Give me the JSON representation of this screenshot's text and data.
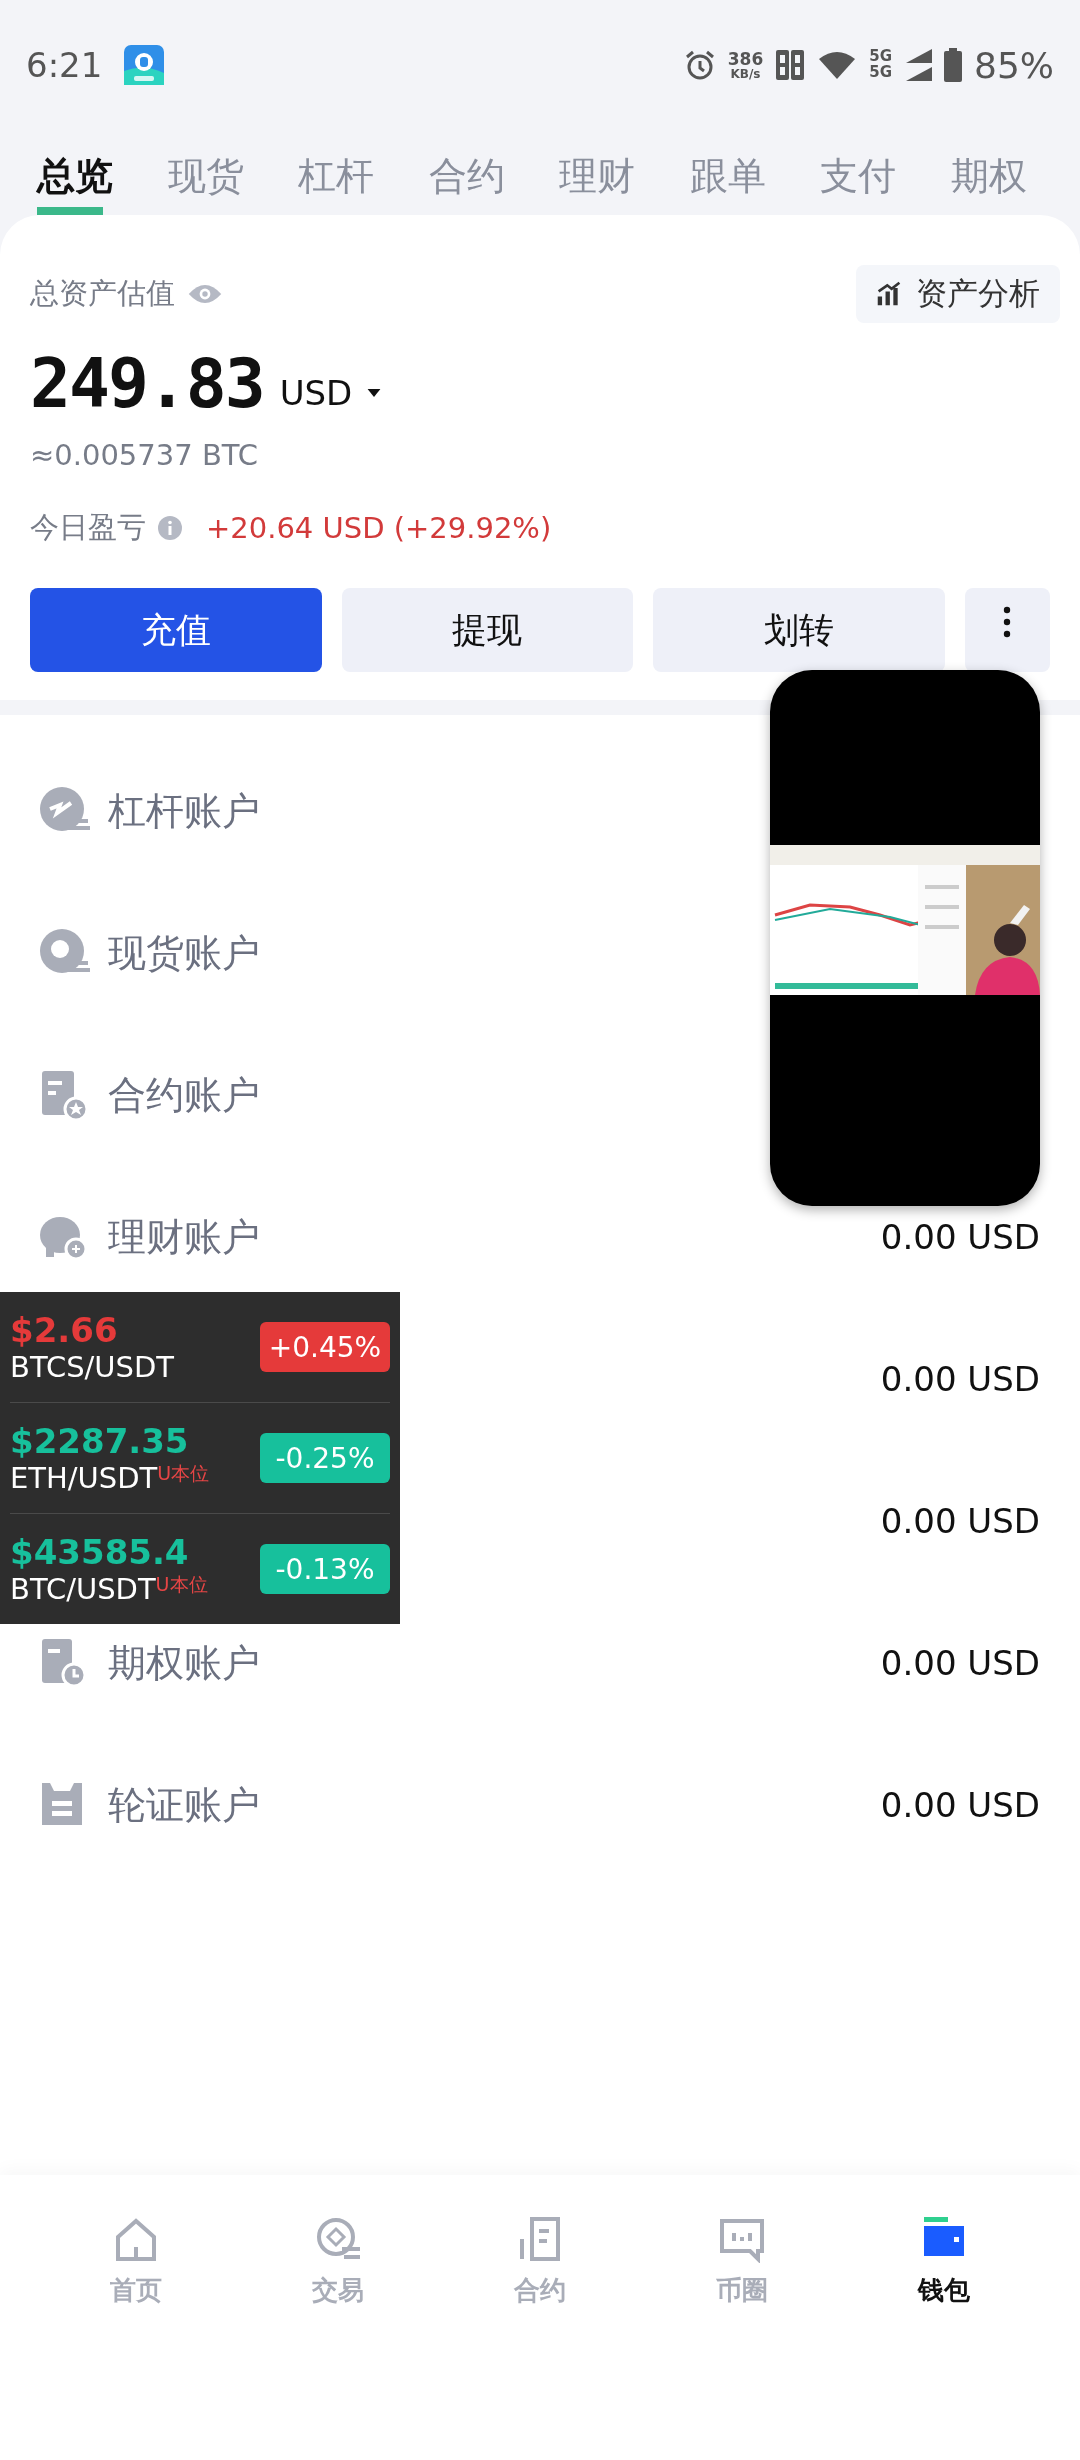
{
  "status_bar": {
    "time": "6:21",
    "network_speed": "386",
    "network_speed_unit": "KB/s",
    "signal_labels": [
      "5G",
      "5G"
    ],
    "battery": "85%"
  },
  "tabs": [
    {
      "label": "总览",
      "selected": true
    },
    {
      "label": "现货",
      "selected": false
    },
    {
      "label": "杠杆",
      "selected": false
    },
    {
      "label": "合约",
      "selected": false
    },
    {
      "label": "理财",
      "selected": false
    },
    {
      "label": "跟单",
      "selected": false
    },
    {
      "label": "支付",
      "selected": false
    },
    {
      "label": "期权",
      "selected": false
    }
  ],
  "assets": {
    "title": "总资产估值",
    "analysis_button": "资产分析",
    "total": "249.83",
    "currency": "USD",
    "btc_equivalent": "≈0.005737 BTC",
    "pnl_label": "今日盈亏",
    "pnl_value": "+20.64 USD (+29.92%)"
  },
  "actions": [
    {
      "label": "充值",
      "primary": true
    },
    {
      "label": "提现",
      "primary": false
    },
    {
      "label": "划转",
      "primary": false
    }
  ],
  "accounts": [
    {
      "name": "杠杆账户"
    },
    {
      "name": "现货账户"
    },
    {
      "name": "合约账户"
    },
    {
      "name": "理财账户",
      "value": "0.00 USD"
    },
    {
      "value": "0.00 USD"
    },
    {
      "value": "0.00 USD"
    },
    {
      "name": "期权账户",
      "value": "0.00 USD"
    },
    {
      "name": "轮证账户",
      "value": "0.00 USD"
    }
  ],
  "ticker": [
    {
      "price": "$2.66",
      "pair": "BTCS/USDT",
      "change": "+0.45%",
      "color": "#e53a3a"
    },
    {
      "price": "$2287.35",
      "pair": "ETH/USDT",
      "tag": "U本位",
      "change": "-0.25%",
      "color": "#17c09c"
    },
    {
      "price": "$43585.4",
      "pair": "BTC/USDT",
      "tag": "U本位",
      "change": "-0.13%",
      "color": "#17c09c"
    }
  ],
  "bottom_nav": [
    {
      "label": "首页",
      "selected": false
    },
    {
      "label": "交易",
      "selected": false
    },
    {
      "label": "合约",
      "selected": false
    },
    {
      "label": "币圈",
      "selected": false
    },
    {
      "label": "钱包",
      "selected": true
    }
  ]
}
